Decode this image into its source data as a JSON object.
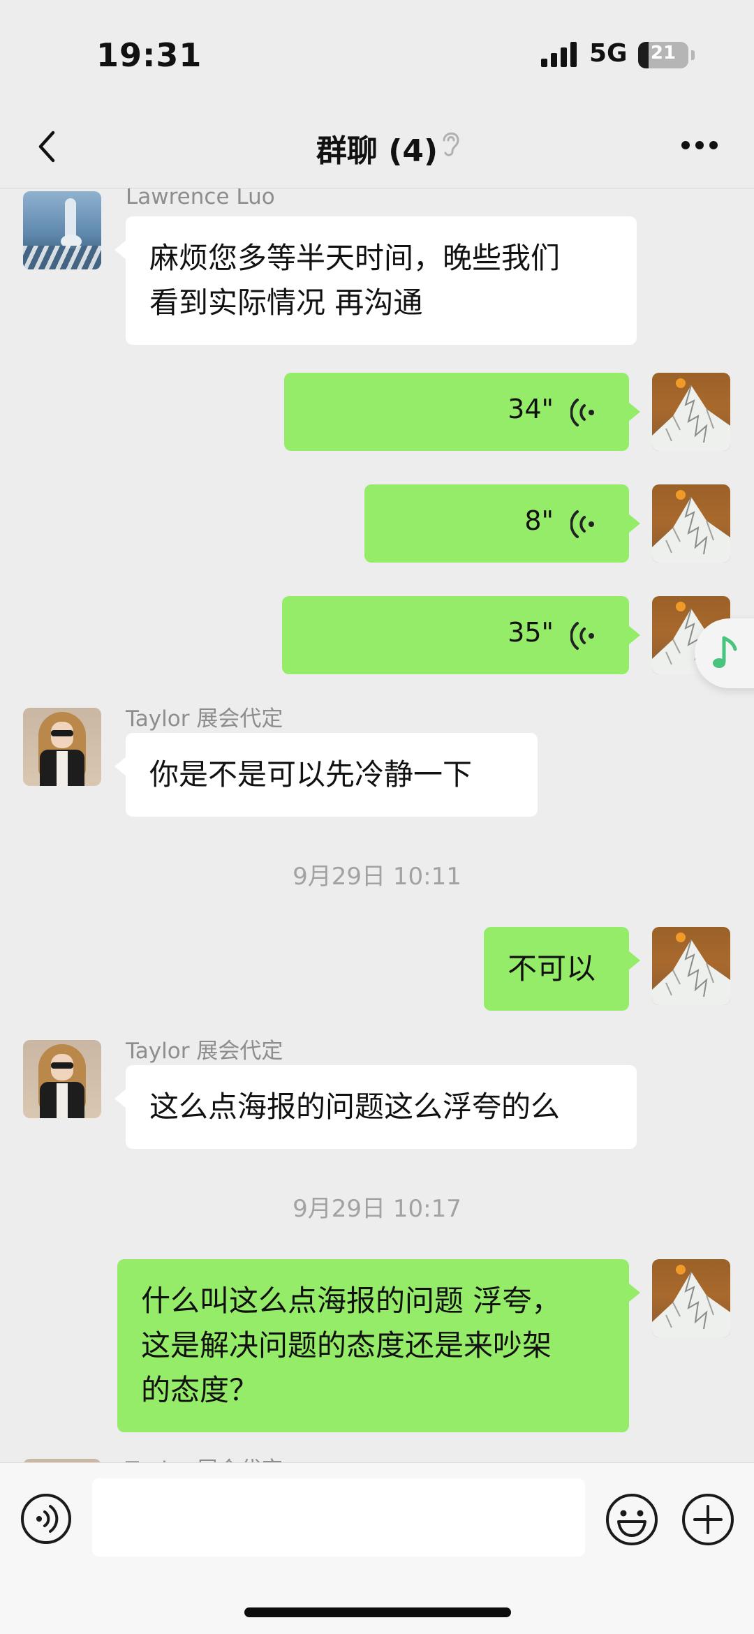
{
  "status_bar": {
    "time": "19:31",
    "network": "5G",
    "battery_percent": "21",
    "battery_level": 0.21
  },
  "nav": {
    "title": "群聊 (4)",
    "back_icon": "chevron-left-icon",
    "ear_icon": "ear-icon",
    "more_icon": "ellipsis-icon"
  },
  "messages": [
    {
      "type": "text",
      "dir": "in",
      "sender": "Lawrence Luo",
      "text": "麻烦您多等半天时间，晚些我们\n看到实际情况 再沟通"
    },
    {
      "type": "voice",
      "dir": "out",
      "duration": "34\""
    },
    {
      "type": "voice",
      "dir": "out",
      "duration": "8\""
    },
    {
      "type": "voice",
      "dir": "out",
      "duration": "35\""
    },
    {
      "type": "text",
      "dir": "in",
      "sender": "Taylor 展会代定",
      "text": "你是不是可以先冷静一下"
    },
    {
      "type": "time",
      "text": "9月29日 10:11"
    },
    {
      "type": "text",
      "dir": "out",
      "text": "不可以"
    },
    {
      "type": "text",
      "dir": "in",
      "sender": "Taylor 展会代定",
      "text": "这么点海报的问题这么浮夸的么"
    },
    {
      "type": "time",
      "text": "9月29日 10:17"
    },
    {
      "type": "text",
      "dir": "out",
      "text": "什么叫这么点海报的问题 浮夸，\n这是解决问题的态度还是来吵架\n的态度？"
    },
    {
      "type": "partial",
      "dir": "in",
      "sender": "Taylor 展会代定"
    }
  ],
  "input_bar": {
    "voice_icon": "voice-input-icon",
    "emoji_icon": "emoji-icon",
    "plus_icon": "plus-icon"
  },
  "floating": {
    "music_icon": "music-note-icon"
  },
  "colors": {
    "background": "#ededed",
    "outgoing_bubble": "#95ec69",
    "incoming_bubble": "#ffffff",
    "meta_text": "#8d8d8d"
  }
}
